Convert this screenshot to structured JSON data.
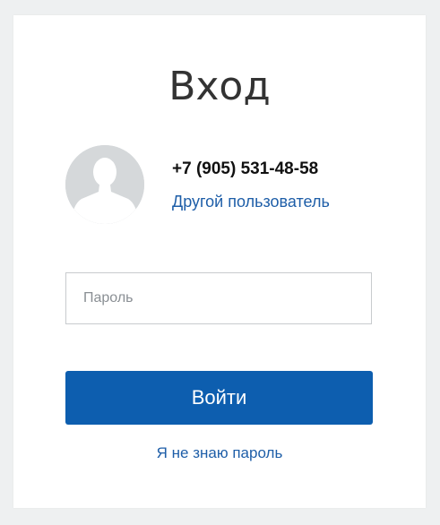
{
  "page": {
    "title": "Вход"
  },
  "user": {
    "phone": "+7 (905) 531-48-58",
    "other_user_link": "Другой пользователь",
    "avatar_icon": "user-silhouette-icon"
  },
  "form": {
    "password_placeholder": "Пароль",
    "password_value": "",
    "login_button": "Войти",
    "forgot_password_link": "Я не знаю пароль"
  },
  "colors": {
    "accent": "#0d5eaf",
    "link": "#1e5ea8",
    "background": "#eef0f1",
    "card": "#ffffff"
  }
}
